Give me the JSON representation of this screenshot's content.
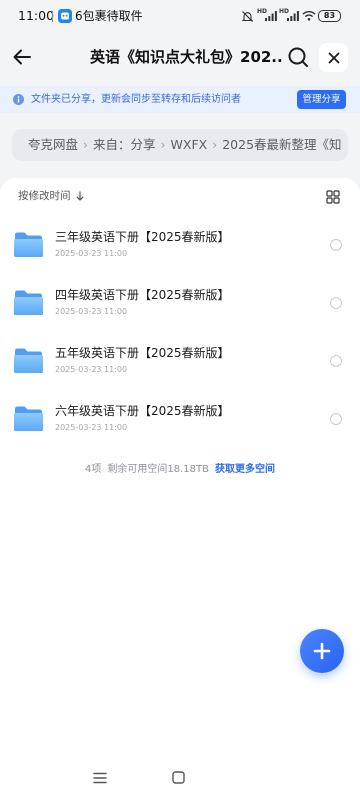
{
  "status_bar": {
    "time": "11:00",
    "notification_text": "6包裹待取件",
    "notification_app_icon": "package-app-icon",
    "icons": [
      "silent-mode-icon",
      "signal-icon",
      "signal-icon",
      "wifi-icon",
      "battery-icon"
    ],
    "network_labels": [
      "HD",
      "HD"
    ],
    "battery_level": "83"
  },
  "header": {
    "title": "英语《知识点大礼包》202...",
    "back_icon": "back-arrow-icon",
    "search_icon": "search-icon",
    "close_icon": "close-icon"
  },
  "share_banner": {
    "icon": "info-icon",
    "text": "文件夹已分享，更新会同步至转存和后续访问者",
    "button_label": "管理分享"
  },
  "breadcrumb": {
    "separator": "›",
    "items": [
      "夸克网盘",
      "来自：分享",
      "WXFX",
      "2025春最新整理《知"
    ]
  },
  "toolbar": {
    "sort_label": "按修改时间",
    "sort_direction_icon": "arrow-down-icon",
    "view_toggle_icon": "grid-view-icon"
  },
  "files": [
    {
      "name": "三年级英语下册【2025春新版】",
      "modified": "2025-03-23 11:00",
      "icon": "folder-icon",
      "selected": false
    },
    {
      "name": "四年级英语下册【2025春新版】",
      "modified": "2025-03-23 11:00",
      "icon": "folder-icon",
      "selected": false
    },
    {
      "name": "五年级英语下册【2025春新版】",
      "modified": "2025-03-23 11:00",
      "icon": "folder-icon",
      "selected": false
    },
    {
      "name": "六年级英语下册【2025春新版】",
      "modified": "2025-03-23 11:00",
      "icon": "folder-icon",
      "selected": false
    }
  ],
  "footer": {
    "item_count": "4项",
    "free_space": "剩余可用空间18.18TB",
    "link": "获取更多空间"
  },
  "fab": {
    "icon": "plus-icon"
  },
  "nav_bar": {
    "icons": [
      "menu-icon",
      "home-icon"
    ]
  },
  "colors": {
    "accent": "#2d6cf6",
    "banner_background": "#e9f1fe",
    "banner_text": "#3b6ad8",
    "page_background": "#f3f4f6",
    "card_background": "#ffffff",
    "folder_front": "#7cc0fa",
    "folder_back": "#4f9ef0"
  }
}
